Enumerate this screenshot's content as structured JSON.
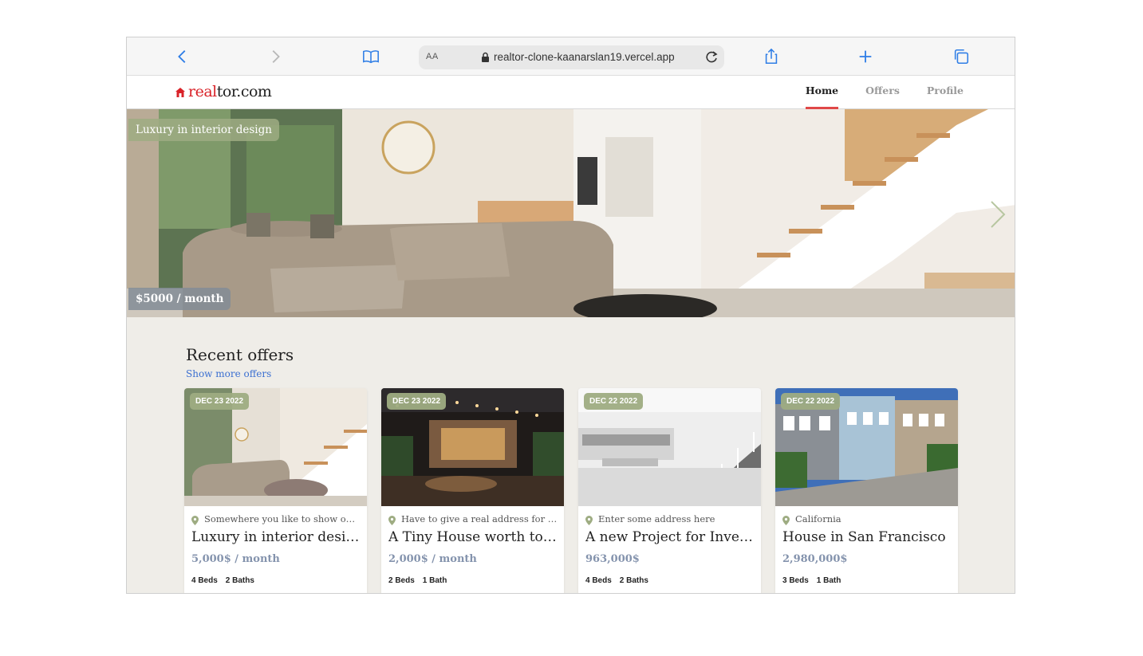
{
  "browser": {
    "text_size_label": "AA",
    "url": "realtor-clone-kaanarslan19.vercel.app"
  },
  "site": {
    "logo_part1": "real",
    "logo_part2": "tor.com",
    "brand_color": "#d92228",
    "nav": [
      {
        "label": "Home",
        "active": true
      },
      {
        "label": "Offers",
        "active": false
      },
      {
        "label": "Profile",
        "active": false
      }
    ]
  },
  "hero": {
    "title": "Luxury in interior design",
    "price": "$5000 / month"
  },
  "offers": {
    "heading": "Recent offers",
    "more_link": "Show more offers",
    "cards": [
      {
        "date": "DEC 23 2022",
        "location": "Somewhere you like to show on map",
        "name": "Luxury in interior design",
        "price": "5,000$ / month",
        "beds": "4 Beds",
        "baths": "2 Baths"
      },
      {
        "date": "DEC 23 2022",
        "location": "Have to give a real address for map",
        "name": "A Tiny House worth to explore",
        "price": "2,000$ / month",
        "beds": "2 Beds",
        "baths": "1 Bath"
      },
      {
        "date": "DEC 22 2022",
        "location": "Enter some address here",
        "name": "A new Project for Investors",
        "price": "963,000$",
        "beds": "4 Beds",
        "baths": "2 Baths"
      },
      {
        "date": "DEC 22 2022",
        "location": "California",
        "name": "House in San Francisco",
        "price": "2,980,000$",
        "beds": "3 Beds",
        "baths": "1 Bath"
      }
    ]
  },
  "colors": {
    "accent_link": "#3b6fd1",
    "tag_green": "#9eac82",
    "price_text": "#8493ad",
    "nav_active_underline": "#e04848"
  }
}
